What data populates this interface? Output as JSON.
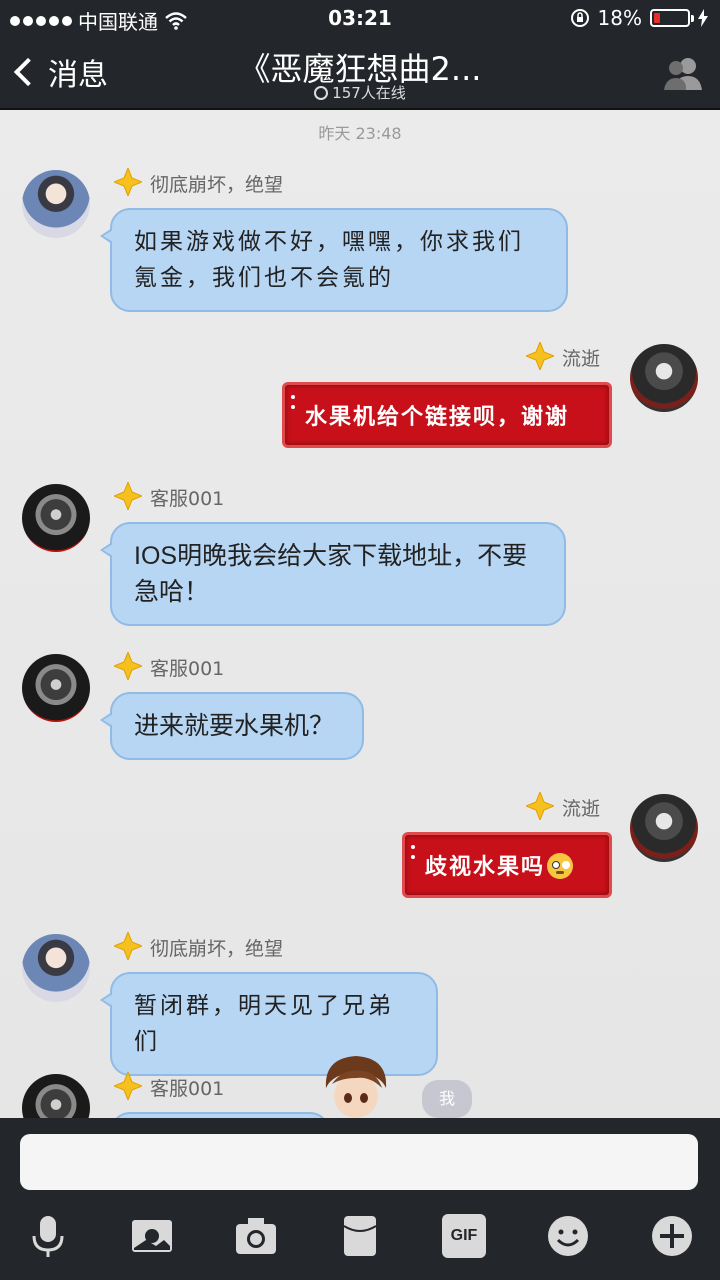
{
  "status_bar": {
    "carrier": "中国联通",
    "time": "03:21",
    "battery_percent": "18%",
    "battery_level": 0.18,
    "battery_color": "#e3302a"
  },
  "header": {
    "back_label": "消息",
    "title": "《恶魔狂想曲2...",
    "online_count": "157人在线"
  },
  "chat": {
    "timestamp": "昨天 23:48",
    "messages": [
      {
        "sender": "彻底崩坏，绝望",
        "text": "如果游戏做不好，嘿嘿，你求我们氪金，我们也不会氪的",
        "side": "left"
      },
      {
        "sender": "流逝",
        "text": "水果机给个链接呗，谢谢",
        "side": "right"
      },
      {
        "sender": "客服001",
        "text": "IOS明晚我会给大家下载地址，不要急哈！",
        "side": "left"
      },
      {
        "sender": "客服001",
        "text": "进来就要水果机？",
        "side": "left"
      },
      {
        "sender": "流逝",
        "text": "歧视水果吗",
        "side": "right"
      },
      {
        "sender": "彻底崩坏，绝望",
        "text": "暂闭群，明天见了兄弟们",
        "side": "left"
      },
      {
        "sender": "客服001",
        "text": "",
        "side": "left"
      }
    ],
    "me_badge": "我"
  },
  "toolbar": {
    "gif_label": "GIF",
    "icons": [
      "microphone-icon",
      "image-icon",
      "camera-icon",
      "red-packet-icon",
      "gif-icon",
      "emoji-icon",
      "plus-icon"
    ]
  }
}
